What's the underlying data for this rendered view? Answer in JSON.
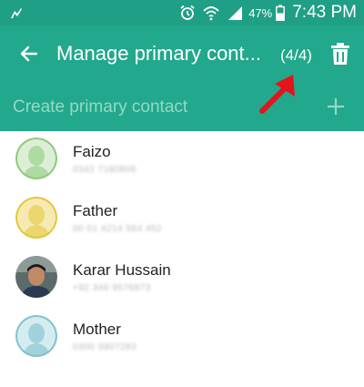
{
  "status_bar": {
    "battery": "47%",
    "time": "7:43 PM",
    "icons": [
      "usb-debug-icon",
      "alarm-icon",
      "wifi-icon",
      "signal-icon",
      "battery-icon"
    ]
  },
  "app_bar": {
    "title": "Manage primary cont...",
    "count": "(4/4)",
    "icons": [
      "back-arrow-icon",
      "trash-icon"
    ]
  },
  "create_row": {
    "label": "Create primary contact",
    "icon": "plus-icon"
  },
  "contacts": [
    {
      "name": "Faizo",
      "number": "0342 7180806",
      "avatar_color": "#8cc97b"
    },
    {
      "name": "Father",
      "number": "0",
      "avatar_color": "#e3c53a"
    },
    {
      "name": "Karar Hussain",
      "number": "+92 346 9576873",
      "avatar_color": "photo"
    },
    {
      "name": "Mother",
      "number": "0300 3907283",
      "avatar_color": "#7fc1cd"
    }
  ],
  "colors": {
    "header": "#22a88c",
    "status_bar": "#1f9f86",
    "create_label": "#93d9c8",
    "annotation": "#e2141c"
  }
}
